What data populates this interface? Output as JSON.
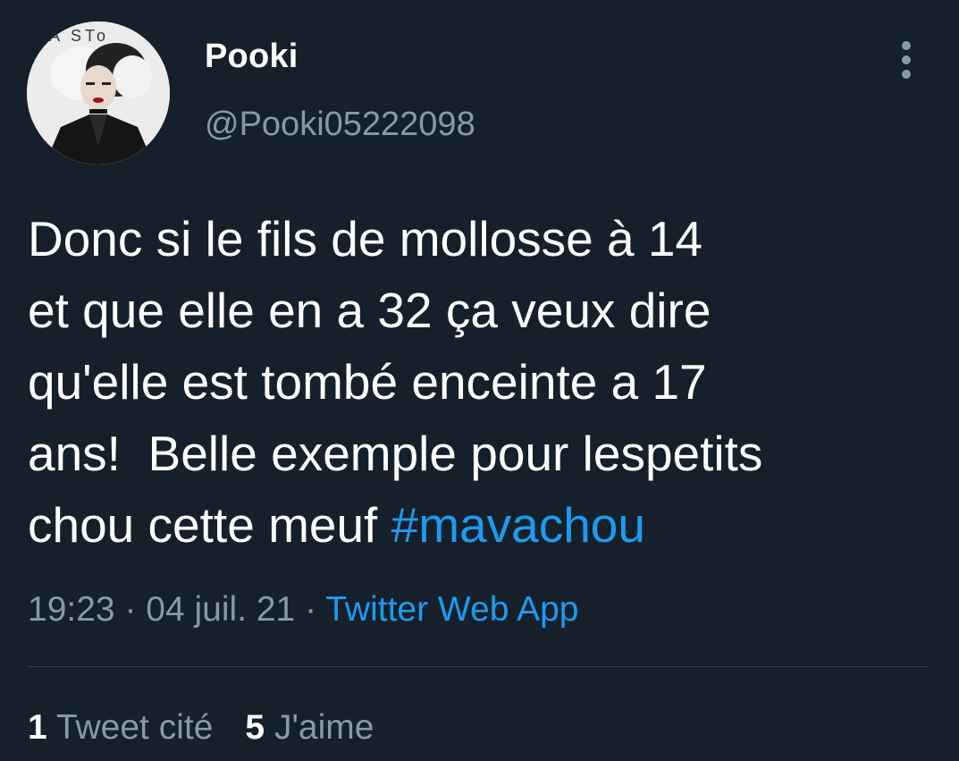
{
  "tweet": {
    "author": {
      "display_name": "Pooki",
      "handle": "@Pooki05222098",
      "avatar_text": "MA STo"
    },
    "text_before_hashtag": "Donc si le fils de mollosse à 14\net que elle en a 32 ça veux dire\nqu'elle est tombé enceinte a 17\nans!  Belle exemple pour lespetits\nchou cette meuf ",
    "hashtag": "#mavachou",
    "time": "19:23",
    "date": "04 juil. 21",
    "separator": "·",
    "source": "Twitter Web App",
    "stats": {
      "quotes_count": "1",
      "quotes_label": "Tweet cité",
      "likes_count": "5",
      "likes_label": "J'aime"
    }
  },
  "colors": {
    "background": "#15202b",
    "primary_text": "#ffffff",
    "secondary_text": "#8899a6",
    "accent": "#1d9bf0",
    "divider": "#38444d"
  },
  "icons": {
    "more": "more-vertical-icon"
  }
}
